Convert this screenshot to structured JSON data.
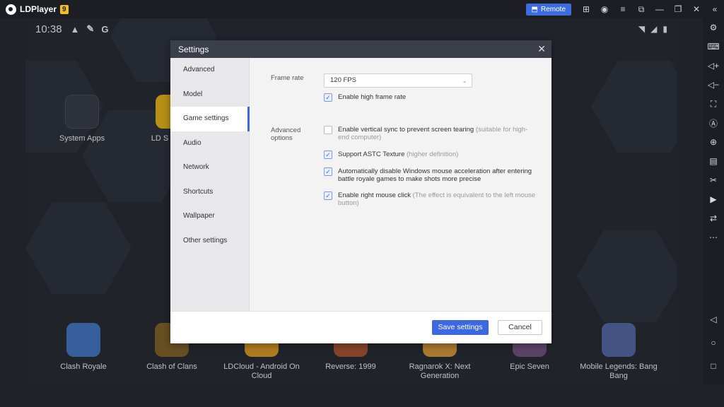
{
  "titlebar": {
    "app_name": "LDPlayer",
    "badge": "9",
    "remote_label": "Remote"
  },
  "statusbar": {
    "time": "10:38"
  },
  "desktop_apps": [
    {
      "label": "System Apps"
    },
    {
      "label": "LD S"
    }
  ],
  "dock_apps": [
    {
      "label": "Clash Royale"
    },
    {
      "label": "Clash of Clans"
    },
    {
      "label": "LDCloud - Android On Cloud"
    },
    {
      "label": "Reverse: 1999"
    },
    {
      "label": "Ragnarok X: Next Generation"
    },
    {
      "label": "Epic Seven"
    },
    {
      "label": "Mobile Legends: Bang Bang"
    }
  ],
  "dialog": {
    "title": "Settings",
    "nav": [
      {
        "label": "Advanced"
      },
      {
        "label": "Model"
      },
      {
        "label": "Game settings"
      },
      {
        "label": "Audio"
      },
      {
        "label": "Network"
      },
      {
        "label": "Shortcuts"
      },
      {
        "label": "Wallpaper"
      },
      {
        "label": "Other settings"
      }
    ],
    "active_nav": "Game settings",
    "frame_rate_label": "Frame rate",
    "frame_rate_value": "120 FPS",
    "high_frame_rate_label": "Enable high frame rate",
    "high_frame_rate_checked": true,
    "advanced_options_label": "Advanced options",
    "options": [
      {
        "label": "Enable vertical sync to prevent screen tearing",
        "note": "(suitable for high-end computer)",
        "checked": false
      },
      {
        "label": "Support ASTC Texture",
        "note": "(higher definition)",
        "checked": true
      },
      {
        "label": "Automatically disable Windows mouse acceleration after entering battle royale games to make shots more precise",
        "note": "",
        "checked": true
      },
      {
        "label": "Enable right mouse click",
        "note": "(The effect is equivalent to the left mouse button)",
        "checked": true
      }
    ],
    "save_label": "Save settings",
    "cancel_label": "Cancel"
  },
  "colors": {
    "accent": "#3c68e0",
    "dialog_header": "#3a3f4a"
  }
}
